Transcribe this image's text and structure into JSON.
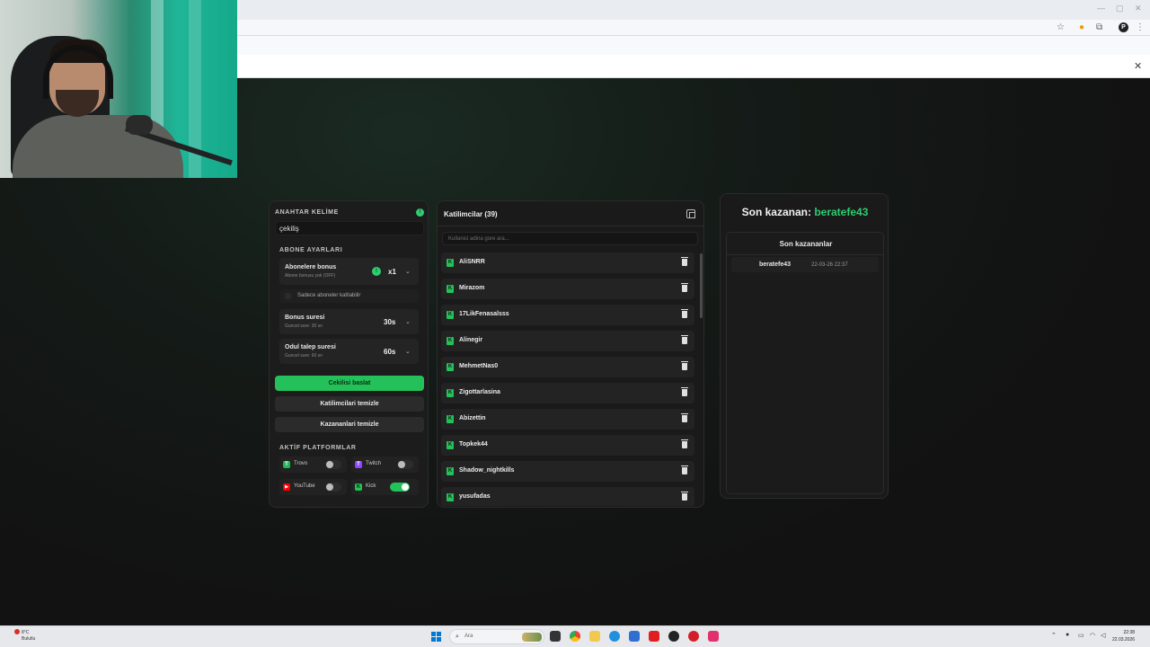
{
  "keyword": {
    "label": "ANAHTAR KELİME",
    "value": "çekiliş",
    "info": "!"
  },
  "subscriber": {
    "section": "ABONE AYARLARI",
    "bonus": {
      "title": "Abonelere bonus",
      "sub": "Abone bonusu yok (OFF)",
      "value": "x1",
      "info": "!"
    },
    "only_subs": "Sadece aboneler katilabilir",
    "bonus_time": {
      "title": "Bonus suresi",
      "sub": "Guncel sure: 30 sn",
      "value": "30s"
    },
    "claim_time": {
      "title": "Odul talep suresi",
      "sub": "Guncel sure: 60 sn",
      "value": "60s"
    }
  },
  "buttons": {
    "start": "Cekilisi baslat",
    "clear_participants": "Katilimcilari temizle",
    "clear_winners": "Kazananlari temizle"
  },
  "platforms": {
    "section": "AKTİF PLATFORMLAR",
    "items": [
      {
        "name": "Trovo",
        "on": false,
        "color": "#1db954",
        "glyph": "T"
      },
      {
        "name": "Twitch",
        "on": false,
        "color": "#9146ff",
        "glyph": "T"
      },
      {
        "name": "YouTube",
        "on": false,
        "color": "#ff0000",
        "glyph": "▶"
      },
      {
        "name": "Kick",
        "on": true,
        "color": "#24c15a",
        "glyph": "K"
      }
    ]
  },
  "participants": {
    "title": "Katilimcilar (39)",
    "search_placeholder": "Kullanici adina gore ara...",
    "items": [
      "AliSNRR",
      "Mirazom",
      "17LikFenasalsss",
      "Alinegir",
      "MehmetNas0",
      "Zigottarlasina",
      "Abizettin",
      "Topkek44",
      "Shadow_nightkills",
      "yusufadas"
    ]
  },
  "winner": {
    "label": "Son kazanan:",
    "name": "beratefe43"
  },
  "winners_list": {
    "title": "Son kazananlar",
    "items": [
      {
        "name": "beratefe43",
        "date": "22-03-26 22:37"
      }
    ]
  },
  "taskbar": {
    "weather_temp": "8°C",
    "weather_desc": "Bulutlu",
    "search_placeholder": "Ara",
    "time": "22:38",
    "date": "22.03.2026"
  },
  "colors": {
    "accent": "#24c15a",
    "winner": "#2ecc71",
    "background": "#121212"
  }
}
